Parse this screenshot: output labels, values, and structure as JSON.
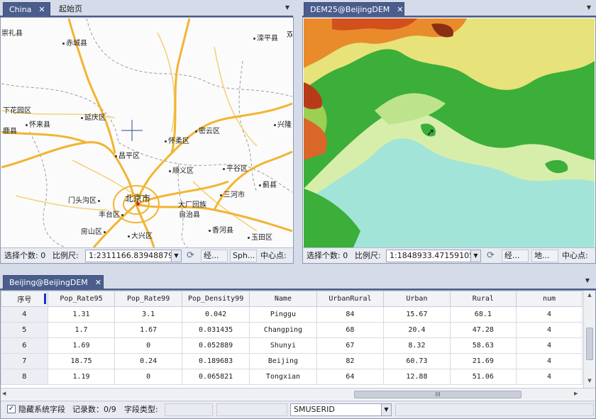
{
  "left_pane": {
    "tabs": [
      {
        "label": "China"
      },
      {
        "label": "起始页"
      }
    ],
    "map_labels": [
      {
        "text": "崇礼县"
      },
      {
        "text": "赤城县"
      },
      {
        "text": "滦平县"
      },
      {
        "text": "双"
      },
      {
        "text": "下花园区"
      },
      {
        "text": "延庆区"
      },
      {
        "text": "怀来县"
      },
      {
        "text": "鹿县"
      },
      {
        "text": "怀柔区"
      },
      {
        "text": "密云区"
      },
      {
        "text": "兴隆"
      },
      {
        "text": "昌平区"
      },
      {
        "text": "顺义区"
      },
      {
        "text": "平谷区"
      },
      {
        "text": "蓟县"
      },
      {
        "text": "门头沟区"
      },
      {
        "text": "北京市"
      },
      {
        "text": "三河市"
      },
      {
        "text": "大厂回族"
      },
      {
        "text": "自治县"
      },
      {
        "text": "丰台区"
      },
      {
        "text": "房山区"
      },
      {
        "text": "大兴区"
      },
      {
        "text": "香河县"
      },
      {
        "text": "玉田区"
      }
    ],
    "status": {
      "selection_label": "选择个数: 0",
      "scale_label": "比例尺:",
      "scale_value": "1:2311166.83948879",
      "btn_trans": "经...",
      "btn_sph": "Sph...",
      "center_label": "中心点:"
    }
  },
  "right_pane": {
    "tabs": [
      {
        "label": "DEM25@BeijingDEM"
      }
    ],
    "status": {
      "selection_label": "选择个数: 0",
      "scale_label": "比例尺:",
      "scale_value": "1:1848933.47159105",
      "btn_trans": "经...",
      "btn_geo": "地...",
      "center_label": "中心点:"
    }
  },
  "bottom_pane": {
    "tabs": [
      {
        "label": "Beijing@BeijingDEM"
      }
    ],
    "columns": [
      "序号",
      "Pop_Rate95",
      "Pop_Rate99",
      "Pop_Density99",
      "Name",
      "UrbanRural",
      "Urban",
      "Rural",
      "num"
    ],
    "rows": [
      [
        "4",
        "1.31",
        "3.1",
        "0.042",
        "Pinggu",
        "84",
        "15.67",
        "68.1",
        "4"
      ],
      [
        "5",
        "1.7",
        "1.67",
        "0.031435",
        "Changping",
        "68",
        "20.4",
        "47.28",
        "4"
      ],
      [
        "6",
        "1.69",
        "0",
        "0.052889",
        "Shunyi",
        "67",
        "8.32",
        "58.63",
        "4"
      ],
      [
        "7",
        "18.75",
        "0.24",
        "0.189683",
        "Beijing",
        "82",
        "60.73",
        "21.69",
        "4"
      ],
      [
        "8",
        "1.19",
        "0",
        "0.065821",
        "Tongxian",
        "64",
        "12.88",
        "51.06",
        "4"
      ]
    ],
    "status": {
      "hide_sys_fields_label": "隐藏系统字段",
      "record_count": "记录数：0/9",
      "field_type_label": "字段类型:",
      "field_select": "SMUSERID"
    },
    "hscroll_grip": "III"
  },
  "colors": {
    "tab_active": "#4a5d8c",
    "road_major": "#f2b431",
    "road_minor": "#f7d37a",
    "boundary": "#9a9a9a"
  }
}
